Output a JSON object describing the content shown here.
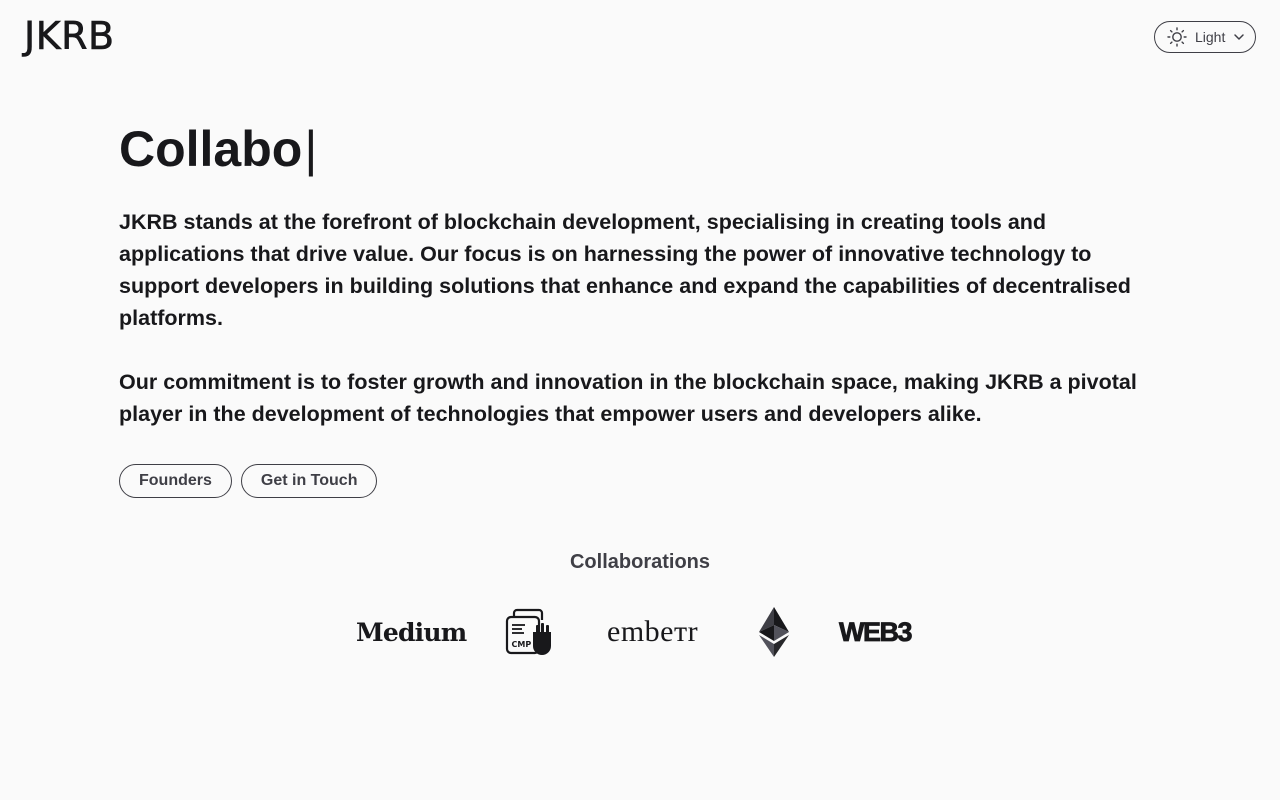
{
  "header": {
    "logo_text": "JKRB",
    "theme_toggle": {
      "icon": "sun-icon",
      "label": "Light",
      "chevron_icon": "chevron-down-icon"
    }
  },
  "main": {
    "headline": "Collabo",
    "headline_cursor": "|",
    "paragraphs": [
      "JKRB stands at the forefront of blockchain development, specialising in creating tools and applications that drive value. Our focus is on harnessing the power of innovative technology to support developers in building solutions that enhance and expand the capabilities of decentralised platforms.",
      "Our commitment is to foster growth and innovation in the blockchain space, making JKRB a pivotal player in the development of technologies that empower users and developers alike."
    ],
    "buttons": {
      "founders": "Founders",
      "contact": "Get in Touch"
    }
  },
  "collaborations": {
    "title": "Collaborations",
    "partners": {
      "medium": "Medium",
      "cmp": "CMP",
      "embetr": "embeтr",
      "ethereum": "ethereum-icon",
      "web3": "WEB3"
    }
  },
  "colors": {
    "background": "#fafafa",
    "text": "#18181b",
    "muted": "#3f3f46"
  }
}
